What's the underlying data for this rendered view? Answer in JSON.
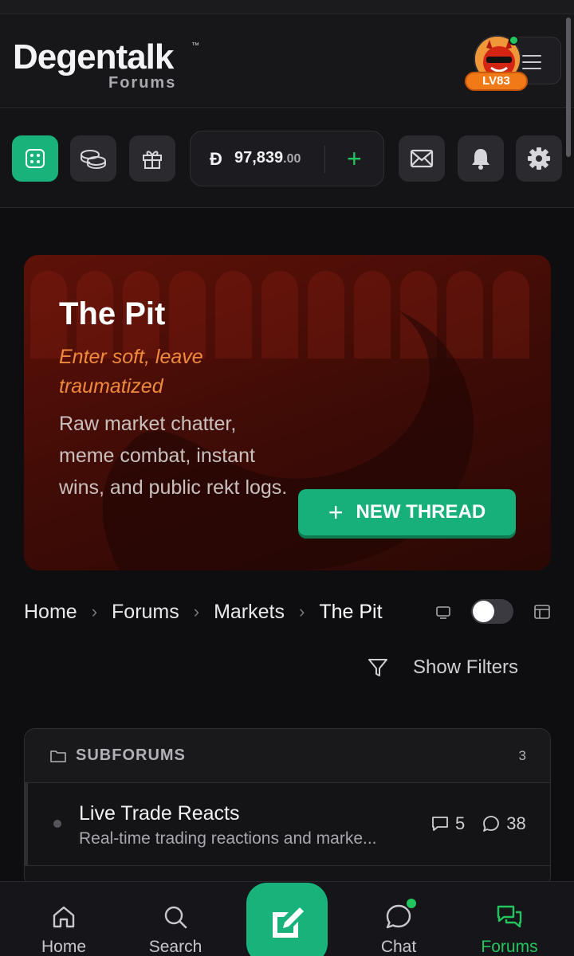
{
  "header": {
    "logo": "Degentalk",
    "logo_tm": "™",
    "logo_sub": "Forums",
    "level_badge": "LV83"
  },
  "wallet": {
    "currency_symbol": "Đ",
    "amount_whole": "97,839",
    "amount_decimal": ".00"
  },
  "hero": {
    "title": "The Pit",
    "tagline": "Enter soft, leave traumatized",
    "description": "Raw market chatter, meme combat, instant wins, and public rekt logs.",
    "new_thread_label": "NEW THREAD",
    "new_thread_icon": "+"
  },
  "breadcrumb": {
    "items": [
      "Home",
      "Forums",
      "Markets",
      "The Pit"
    ],
    "separator": "›"
  },
  "filters": {
    "label": "Show Filters"
  },
  "subforums": {
    "title": "SUBFORUMS",
    "count": "3",
    "items": [
      {
        "name": "Live Trade Reacts",
        "description": "Real-time trading reactions and marke...",
        "threads": "5",
        "posts": "38"
      }
    ]
  },
  "bottom_nav": {
    "items": [
      "Home",
      "Search",
      "Chat",
      "Forums"
    ],
    "active": "Forums"
  },
  "colors": {
    "accent": "#19b27a",
    "hero_red": "#5e1108",
    "tagline_orange": "#f08a3c",
    "level_orange": "#f07a18"
  }
}
